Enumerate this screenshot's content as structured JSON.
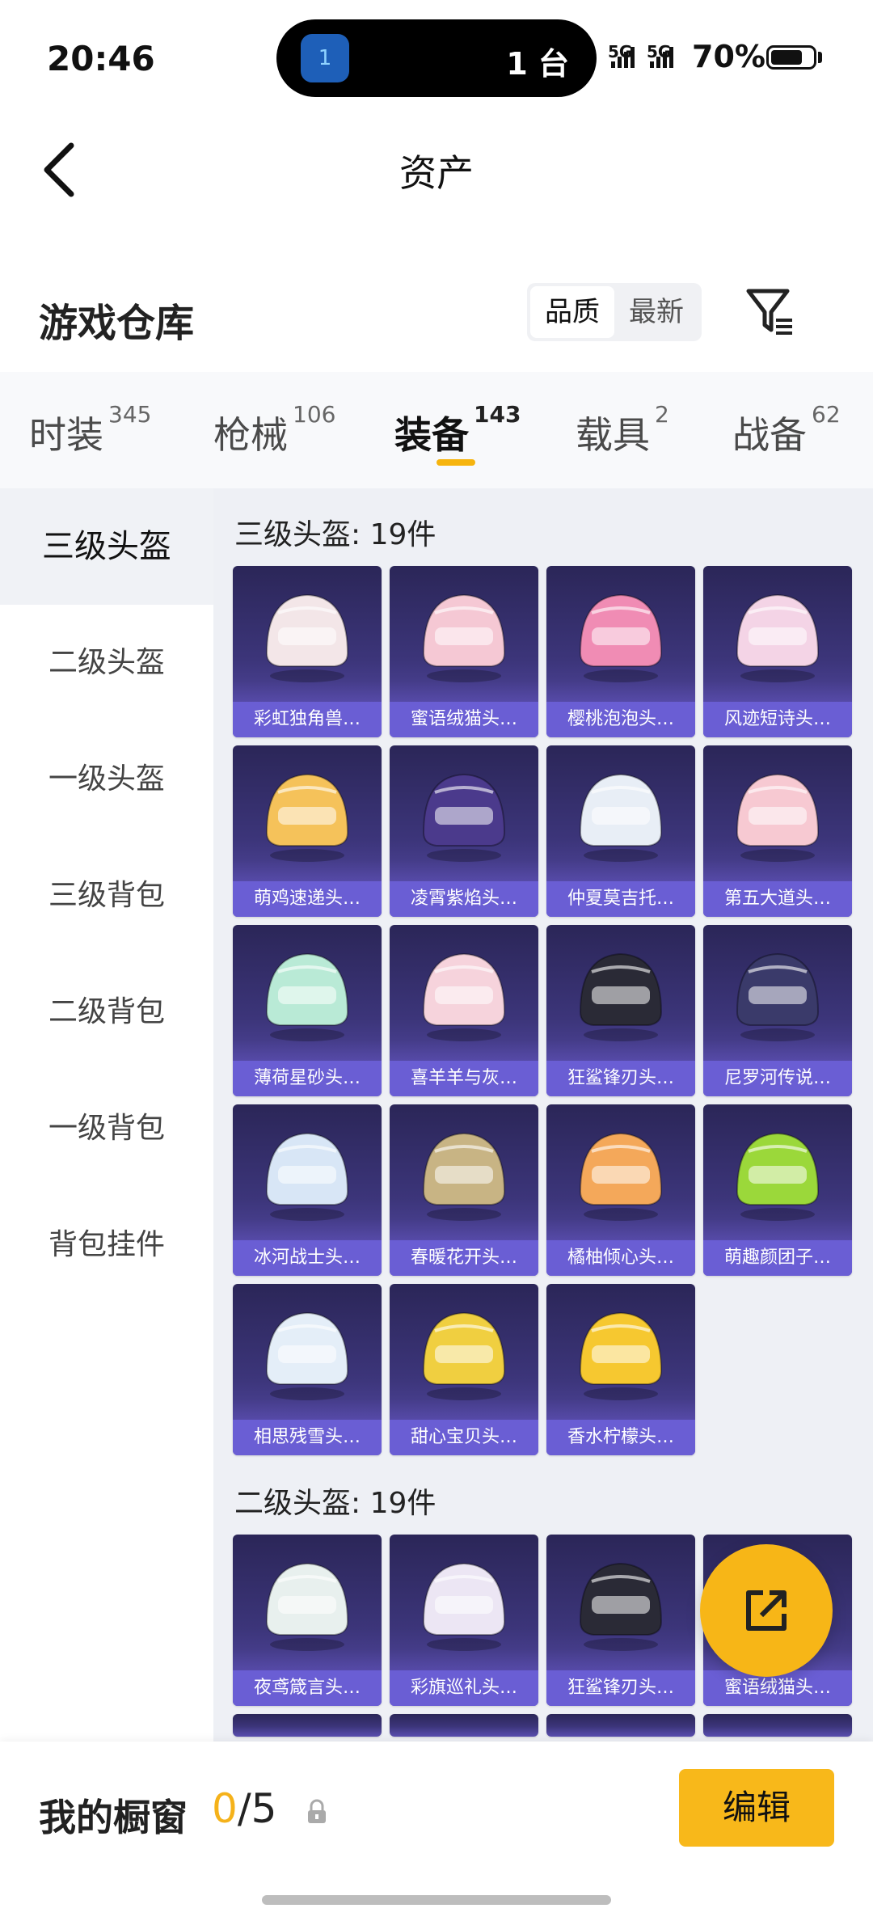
{
  "status_bar": {
    "time": "20:46",
    "island_icon": "1",
    "island_count": "1 台",
    "signal1": "5G",
    "signal2": "5G",
    "battery": "70%"
  },
  "nav": {
    "title": "资产",
    "back_icon": "chevron-left-icon"
  },
  "warehouse": {
    "title": "游戏仓库",
    "sort_options": [
      "品质",
      "最新"
    ],
    "sort_active": "品质"
  },
  "tabs": [
    {
      "label": "时装",
      "count": "345"
    },
    {
      "label": "枪械",
      "count": "106"
    },
    {
      "label": "装备",
      "count": "143"
    },
    {
      "label": "载具",
      "count": "2"
    },
    {
      "label": "战备",
      "count": "62"
    }
  ],
  "active_tab": "装备",
  "sidebar": [
    "三级头盔",
    "二级头盔",
    "一级头盔",
    "三级背包",
    "二级背包",
    "一级背包",
    "背包挂件"
  ],
  "sections": [
    {
      "title": "三级头盔: 19件",
      "items": [
        "彩虹独角兽…",
        "蜜语绒猫头…",
        "樱桃泡泡头…",
        "风迹短诗头…",
        "萌鸡速递头…",
        "凌霄紫焰头…",
        "仲夏莫吉托…",
        "第五大道头…",
        "薄荷星砂头…",
        "喜羊羊与灰…",
        "狂鲨锋刃头…",
        "尼罗河传说…",
        "冰河战士头…",
        "春暖花开头…",
        "橘柚倾心头…",
        "萌趣颜团子…",
        "相思残雪头…",
        "甜心宝贝头…",
        "香水柠檬头…"
      ],
      "colors": [
        "#f3e6e8",
        "#f5c8d4",
        "#f08cb4",
        "#f4d4e6",
        "#f5c25a",
        "#4b3a8c",
        "#e8eef6",
        "#f7c9d2",
        "#b9ead6",
        "#f6d3dc",
        "#2a2a36",
        "#3a3a6a",
        "#d8e6f6",
        "#c8b484",
        "#f4a85a",
        "#9bd83a",
        "#e4eef8",
        "#f0cf40",
        "#f6c830"
      ]
    },
    {
      "title": "二级头盔: 19件",
      "items": [
        "夜鸢箴言头…",
        "彩旗巡礼头…",
        "狂鲨锋刃头…",
        "蜜语绒猫头…"
      ],
      "colors": [
        "#e8f0ee",
        "#ece6f4",
        "#2a2a36",
        "#f5c8d4"
      ]
    }
  ],
  "fab_icon": "external-link-icon",
  "showcase": {
    "label": "我的橱窗",
    "current": "0",
    "total": "/5",
    "lock_icon": "lock-icon",
    "edit_label": "编辑"
  }
}
